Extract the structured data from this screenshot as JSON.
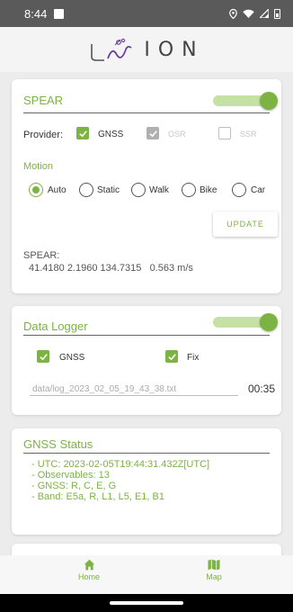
{
  "statusbar": {
    "time": "8:44"
  },
  "brand": {
    "name": "ION"
  },
  "colors": {
    "accent": "#7cb342",
    "accent_light": "#c5e1a5"
  },
  "spear": {
    "title": "SPEAR",
    "provider_label": "Provider:",
    "providers": [
      {
        "label": "GNSS",
        "state": "checked"
      },
      {
        "label": "OSR",
        "state": "checked-disabled"
      },
      {
        "label": "SSR",
        "state": "unchecked"
      }
    ],
    "motion_label": "Motion",
    "motion_options": [
      "Auto",
      "Static",
      "Walk",
      "Bike",
      "Car"
    ],
    "motion_selected": "Auto",
    "update_button": "UPDATE",
    "result_label": "SPEAR:",
    "result_values": "41.4180 2.1960 134.7315   0.563 m/s",
    "enabled": true
  },
  "logger": {
    "title": "Data Logger",
    "enabled": true,
    "options": [
      {
        "label": "GNSS",
        "checked": true
      },
      {
        "label": "Fix",
        "checked": true
      }
    ],
    "file_path": "data/log_2023_02_05_19_43_38.txt",
    "elapsed": "00:35"
  },
  "gnss_status": {
    "title": "GNSS Status",
    "lines": [
      "- UTC: 2023-02-05T19:44:31.432Z[UTC]",
      "- Observables: 13",
      "- GNSS: R, C, E, G",
      "- Band: E5a, R, L1, L5, E1, B1"
    ]
  },
  "nav": {
    "items": [
      {
        "label": "Home",
        "icon": "home-icon"
      },
      {
        "label": "Map",
        "icon": "map-icon"
      }
    ]
  }
}
